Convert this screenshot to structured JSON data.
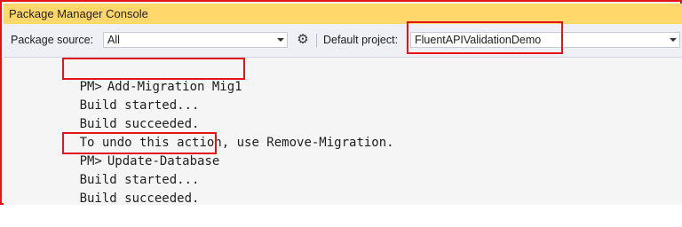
{
  "window": {
    "title": "Package Manager Console"
  },
  "toolbar": {
    "package_source_label": "Package source:",
    "package_source_value": "All",
    "settings_icon": "gear-icon",
    "default_project_label": "Default project:",
    "default_project_value": "FluentAPIValidationDemo"
  },
  "console": {
    "prompt": "PM>",
    "lines": [
      {
        "kind": "command",
        "text": "Add-Migration Mig1"
      },
      {
        "kind": "output",
        "text": "Build started..."
      },
      {
        "kind": "output",
        "text": "Build succeeded."
      },
      {
        "kind": "output",
        "text": "To undo this action, use Remove-Migration."
      },
      {
        "kind": "command",
        "text": "Update-Database"
      },
      {
        "kind": "output",
        "text": "Build started..."
      },
      {
        "kind": "output",
        "text": "Build succeeded."
      }
    ]
  },
  "colors": {
    "title_bar": "#ffd76a",
    "highlight_border": "#e3131a",
    "console_background": "#f5f5f5"
  }
}
